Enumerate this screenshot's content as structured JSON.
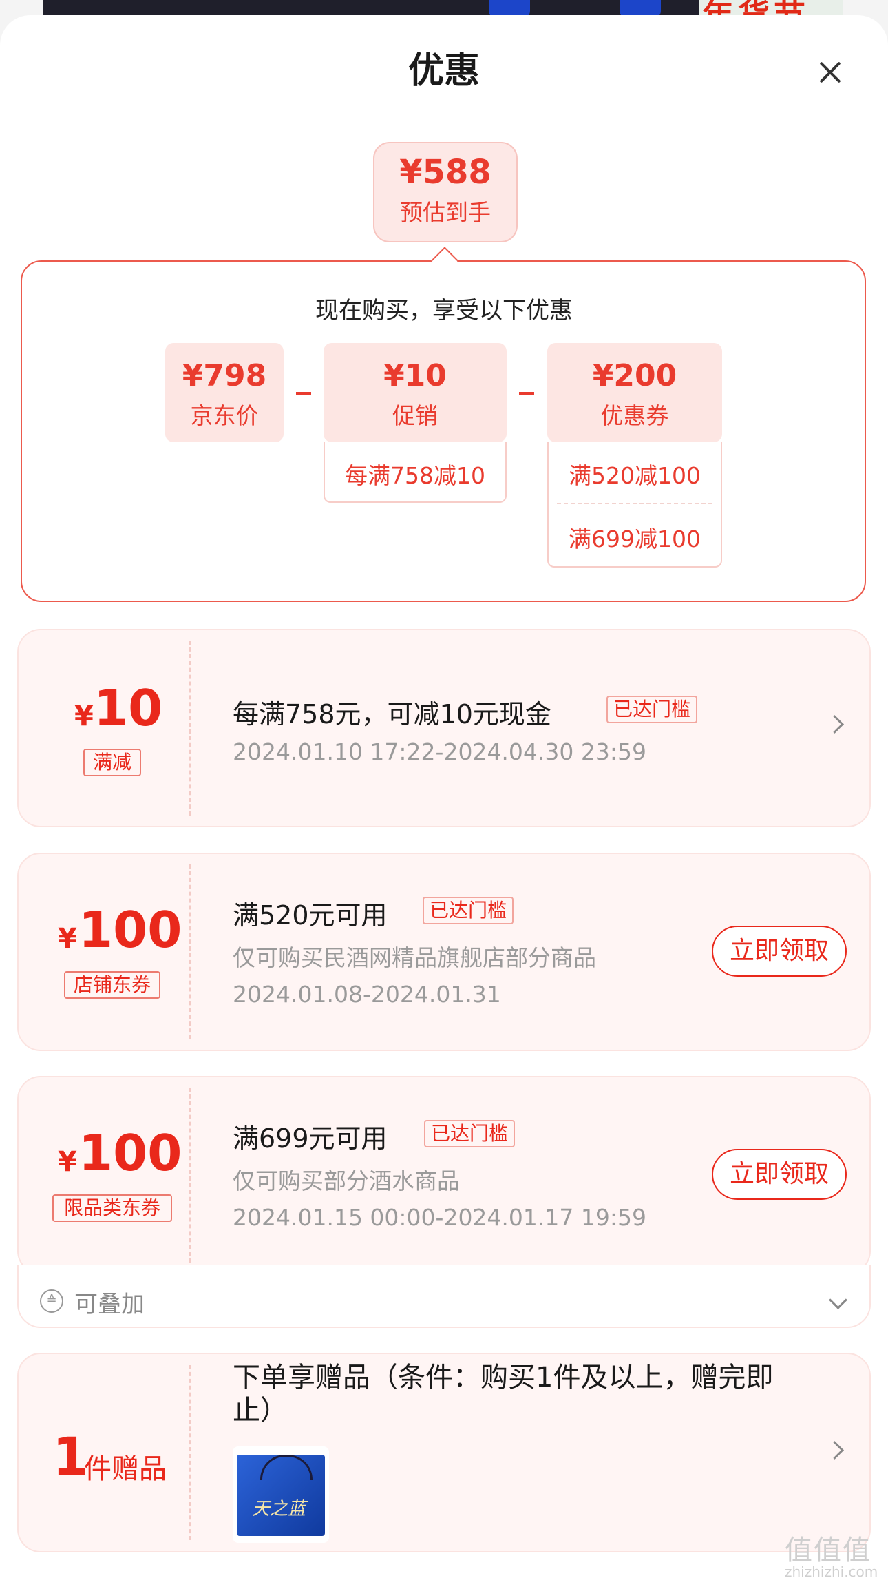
{
  "background": {
    "banner_text": "年货节"
  },
  "header": {
    "title": "优惠"
  },
  "estimate": {
    "price": "¥588",
    "label": "预估到手"
  },
  "breakdown": {
    "heading": "现在购买，享受以下优惠",
    "items": [
      {
        "price": "¥798",
        "label": "京东价"
      },
      {
        "price": "¥10",
        "label": "促销",
        "details": [
          "每满758减10"
        ]
      },
      {
        "price": "¥200",
        "label": "优惠券",
        "details": [
          "满520减100",
          "满699减100"
        ]
      }
    ]
  },
  "promos": [
    {
      "amount": "10",
      "currency": "¥",
      "type": "满减",
      "title": "每满758元，可减10元现金",
      "badge": "已达门槛",
      "period": "2024.01.10 17:22-2024.04.30 23:59"
    },
    {
      "amount": "100",
      "currency": "¥",
      "type": "店铺东券",
      "title": "满520元可用",
      "badge": "已达门槛",
      "scope": "仅可购买民酒网精品旗舰店部分商品",
      "period": "2024.01.08-2024.01.31",
      "action": "立即领取"
    },
    {
      "amount": "100",
      "currency": "¥",
      "type": "限品类东券",
      "title": "满699元可用",
      "badge": "已达门槛",
      "scope": "仅可购买部分酒水商品",
      "period": "2024.01.15 00:00-2024.01.17 19:59",
      "action": "立即领取"
    }
  ],
  "stackable": {
    "label": "可叠加"
  },
  "gift": {
    "count": "1",
    "label": "件赠品",
    "title": "下单享赠品（条件：购买1件及以上，赠完即止）",
    "image_text": "天之蓝"
  },
  "watermark": {
    "mark": "值值值",
    "site": "zhizhizhi.com"
  },
  "colors": {
    "accent": "#e9281b",
    "panel_border": "#ec5a4d",
    "card_bg": "#fff5f4"
  }
}
